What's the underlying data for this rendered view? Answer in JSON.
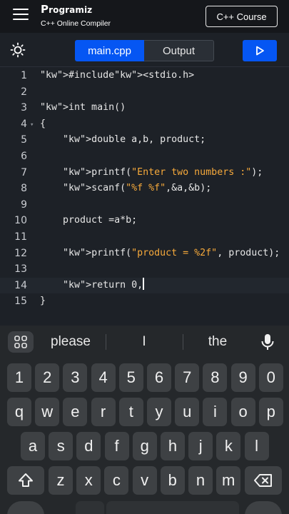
{
  "header": {
    "brand_name": "rogramiz",
    "brand_p": "P",
    "subtitle": "C++ Online Compiler",
    "course_button": "C++ Course"
  },
  "toolbar": {
    "tab_main": "main.cpp",
    "tab_output": "Output"
  },
  "editor": {
    "lines": [
      {
        "n": "1",
        "text": "#include<stdio.h>"
      },
      {
        "n": "2",
        "text": ""
      },
      {
        "n": "3",
        "text": "int main()"
      },
      {
        "n": "4",
        "text": "{"
      },
      {
        "n": "5",
        "text": "    double a,b, product;"
      },
      {
        "n": "6",
        "text": ""
      },
      {
        "n": "7",
        "text": "    printf(\"Enter two numbers :\");"
      },
      {
        "n": "8",
        "text": "    scanf(\"%f %f\",&a,&b);"
      },
      {
        "n": "9",
        "text": ""
      },
      {
        "n": "10",
        "text": "    product =a*b;"
      },
      {
        "n": "11",
        "text": ""
      },
      {
        "n": "12",
        "text": "    printf(\"product = %2f\", product);"
      },
      {
        "n": "13",
        "text": ""
      },
      {
        "n": "14",
        "text": "    return 0,"
      },
      {
        "n": "15",
        "text": "}"
      }
    ],
    "active_line": "14"
  },
  "keyboard": {
    "suggestions": [
      "please",
      "I",
      "the"
    ],
    "number_row": [
      "1",
      "2",
      "3",
      "4",
      "5",
      "6",
      "7",
      "8",
      "9",
      "0"
    ],
    "row1": [
      "q",
      "w",
      "e",
      "r",
      "t",
      "y",
      "u",
      "i",
      "o",
      "p"
    ],
    "row2": [
      "a",
      "s",
      "d",
      "f",
      "g",
      "h",
      "j",
      "k",
      "l"
    ],
    "row3": [
      "z",
      "x",
      "c",
      "v",
      "b",
      "n",
      "m"
    ]
  },
  "colors": {
    "accent": "#0556f3",
    "keyword": "#f6a93b",
    "editor_bg": "#1d2127",
    "keyboard_bg": "#25282b"
  },
  "icons": [
    "hamburger-menu-icon",
    "sun-icon",
    "play-icon",
    "grid-icon",
    "microphone-icon",
    "shift-icon",
    "backspace-icon"
  ]
}
